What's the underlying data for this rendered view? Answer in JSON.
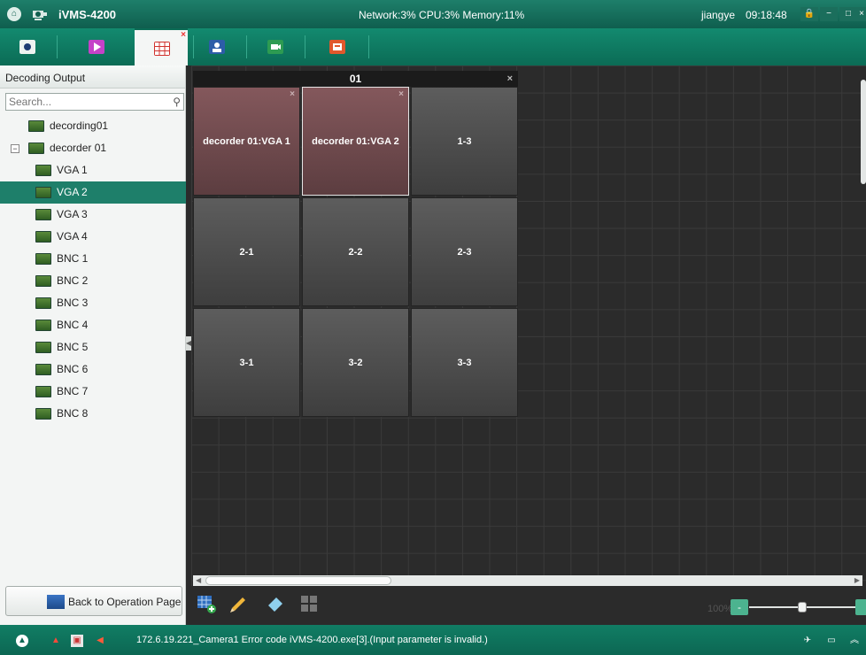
{
  "titlebar": {
    "app_name": "iVMS-4200",
    "stats": "Network:3% CPU:3% Memory:11%",
    "user": "jiangye",
    "time": "09:18:48"
  },
  "modules": [
    {
      "icon": "main-view-icon",
      "active": false
    },
    {
      "icon": "playback-icon",
      "active": false
    },
    {
      "icon": "video-wall-icon",
      "active": true
    },
    {
      "icon": "person-icon",
      "active": false
    },
    {
      "icon": "camera-icon",
      "active": false
    },
    {
      "icon": "log-icon",
      "active": false
    }
  ],
  "left_panel": {
    "title": "Decoding Output",
    "search_placeholder": "Search...",
    "tree": [
      {
        "label": "decording01",
        "level": 0,
        "toggle": ""
      },
      {
        "label": "decorder 01",
        "level": 0,
        "toggle": "−"
      },
      {
        "label": "VGA 1",
        "level": 1
      },
      {
        "label": "VGA 2",
        "level": 1,
        "selected": true
      },
      {
        "label": "VGA 3",
        "level": 1
      },
      {
        "label": "VGA 4",
        "level": 1
      },
      {
        "label": "BNC 1",
        "level": 1
      },
      {
        "label": "BNC 2",
        "level": 1
      },
      {
        "label": "BNC 3",
        "level": 1
      },
      {
        "label": "BNC 4",
        "level": 1
      },
      {
        "label": "BNC 5",
        "level": 1
      },
      {
        "label": "BNC 6",
        "level": 1
      },
      {
        "label": "BNC 7",
        "level": 1
      },
      {
        "label": "BNC 8",
        "level": 1
      }
    ],
    "back_button": "Back to Operation Page"
  },
  "wall": {
    "title": "01",
    "cells": [
      {
        "label": "decorder 01:VGA 1",
        "bound": true,
        "selected": false
      },
      {
        "label": "decorder 01:VGA 2",
        "bound": true,
        "selected": true
      },
      {
        "label": "1-3",
        "bound": false,
        "selected": false
      },
      {
        "label": "2-1",
        "bound": false,
        "selected": false
      },
      {
        "label": "2-2",
        "bound": false,
        "selected": false
      },
      {
        "label": "2-3",
        "bound": false,
        "selected": false
      },
      {
        "label": "3-1",
        "bound": false,
        "selected": false
      },
      {
        "label": "3-2",
        "bound": false,
        "selected": false
      },
      {
        "label": "3-3",
        "bound": false,
        "selected": false
      }
    ]
  },
  "tools": {
    "zoom": "100%"
  },
  "status": {
    "message": "172.6.19.221_Camera1 Error code iVMS-4200.exe[3].(Input parameter is invalid.)"
  },
  "colors": {
    "brand": "#0f5e4e",
    "selected_row": "#1e7f6a",
    "bound_cell": "#84585c"
  }
}
